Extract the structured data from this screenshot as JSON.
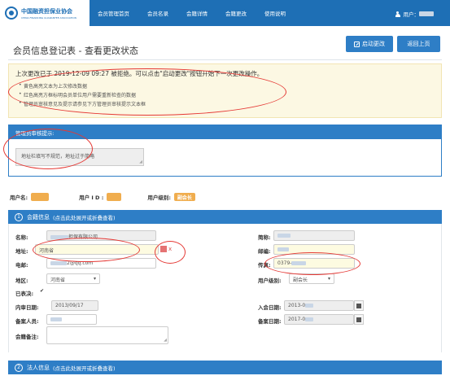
{
  "header": {
    "logo_cn": "中国融资担保业协会",
    "logo_en": "CHINA FINANCING GUARANTEE ASSOCIATION",
    "nav": [
      "会员管理首页",
      "会员名录",
      "会籍详情",
      "会籍更改",
      "使用说明"
    ],
    "user_label": "用户：",
    "colors": {
      "nav_bg": "#1e6fb5",
      "primary": "#2e7ec6",
      "warning": "#f0ad4e",
      "annotation": "#e53935"
    }
  },
  "page": {
    "title": "会员信息登记表 - 查看更改状态",
    "start_button": "启动更改",
    "back_button": "返回上页"
  },
  "notice": {
    "main": "上次更改已于 2019-12-09 09:27 被拒绝。可以点击\"启动更改\"按钮开始下一次更改操作。",
    "items": [
      "黄色高亮文本为上次修改数据",
      "红色高亮方框标明会员单位用户需要重新检查的数据",
      "管理员审核意见及提示请参见下方管理员审核提示文本框"
    ]
  },
  "admin": {
    "title": "管理员审核提示:",
    "message": "地址栏填写不规范，地址过于简略"
  },
  "user_info": {
    "username_label": "用户名:",
    "userid_label": "用户 I D :",
    "level_label": "用户级别:",
    "level_value": "副会长"
  },
  "section1": {
    "number": "1",
    "title": "会籍信息",
    "note": "(点击此处展开或折叠查看)"
  },
  "section2": {
    "number": "2",
    "title": "法人信息",
    "note": "(点击此处展开或折叠查看)"
  },
  "form": {
    "name_label": "名称:",
    "name_value": "担保有限公司",
    "short_label": "简称:",
    "address_label": "地址:",
    "address_value": "河南省",
    "postcode_label": "邮编:",
    "email_label": "电邮:",
    "email_value": "2@qq.com",
    "fax_label": "传真:",
    "fax_value": "0379-",
    "region_label": "地区:",
    "region_value": "河南省",
    "level_label": "用户级别:",
    "level_value": "副会长",
    "voted_label": "已表决:",
    "voted_check": "✔",
    "review_date_label": "内审日期:",
    "review_date_value": "2013/09/17",
    "join_date_label": "入会日期:",
    "join_date_value": "2013-0",
    "record_person_label": "备案人员:",
    "record_date_label": "备案日期:",
    "record_date_value": "2017-0",
    "note_label": "会籍备注:",
    "error_mark": "x"
  }
}
